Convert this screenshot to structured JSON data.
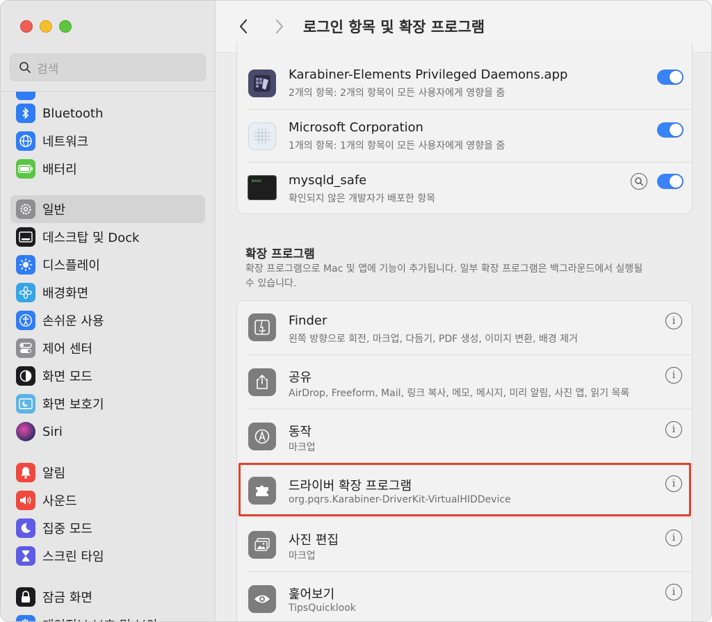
{
  "window": {
    "title": "로그인 항목 및 확장 프로그램"
  },
  "search": {
    "placeholder": "검색"
  },
  "sidebar": {
    "items": [
      {
        "label": "Bluetooth",
        "icon": "bluetooth-icon",
        "color": "#2f7cf6"
      },
      {
        "label": "네트워크",
        "icon": "globe-icon",
        "color": "#2f7cf6"
      },
      {
        "label": "배터리",
        "icon": "battery-icon",
        "color": "#5ac744"
      },
      {
        "label": "일반",
        "icon": "gear-icon",
        "color": "#8e8e93",
        "active": true
      },
      {
        "label": "데스크탑 및 Dock",
        "icon": "dock-icon",
        "color": "#1c1c1e"
      },
      {
        "label": "디스플레이",
        "icon": "sun-icon",
        "color": "#2f7cf6"
      },
      {
        "label": "배경화면",
        "icon": "flower-icon",
        "color": "#36a5e8"
      },
      {
        "label": "손쉬운 사용",
        "icon": "accessibility-icon",
        "color": "#2f7cf6"
      },
      {
        "label": "제어 센터",
        "icon": "toggles-icon",
        "color": "#8e8e93"
      },
      {
        "label": "화면 모드",
        "icon": "appearance-icon",
        "color": "#1c1c1e"
      },
      {
        "label": "화면 보호기",
        "icon": "screensaver-icon",
        "color": "#5ab4e8"
      },
      {
        "label": "Siri",
        "icon": "siri-icon",
        "color": "#3a2d6b"
      },
      {
        "label": "알림",
        "icon": "bell-icon",
        "color": "#f0483e"
      },
      {
        "label": "사운드",
        "icon": "speaker-icon",
        "color": "#f0483e"
      },
      {
        "label": "집중 모드",
        "icon": "moon-icon",
        "color": "#5e5ce6"
      },
      {
        "label": "스크린 타임",
        "icon": "hourglass-icon",
        "color": "#5e5ce6"
      },
      {
        "label": "잠금 화면",
        "icon": "lock-icon",
        "color": "#1c1c1e"
      },
      {
        "label": "개인정보 보호 및 보안",
        "icon": "hand-icon",
        "color": "#2f7cf6"
      }
    ]
  },
  "login_items": [
    {
      "title": "Karabiner-Elements Privileged Daemons.app",
      "subtitle": "2개의 항목: 2개의 항목이 모든 사용자에게 영향을 줌",
      "icon": "karabiner-icon",
      "enabled": true
    },
    {
      "title": "Microsoft Corporation",
      "subtitle": "1개의 항목: 1개의 항목이 모든 사용자에게 영향을 줌",
      "icon": "microsoft-icon",
      "enabled": true
    },
    {
      "title": "mysqld_safe",
      "subtitle": "확인되지 않은 개발자가 배포한 항목",
      "icon": "terminal-icon",
      "enabled": true
    }
  ],
  "extensions": {
    "title": "확장 프로그램",
    "description": "확장 프로그램으로 Mac 및 앱에 기능이 추가됩니다. 일부 확장 프로그램은 백그라운드에서 실행될 수 있습니다.",
    "items": [
      {
        "title": "Finder",
        "subtitle": "왼쪽 방향으로 회전, 마크업, 다듬기, PDF 생성, 이미지 변환, 배경 제거",
        "icon": "finder-icon"
      },
      {
        "title": "공유",
        "subtitle": "AirDrop, Freeform, Mail, 링크 복사, 메모, 메시지, 미리 알림, 사진 앱, 읽기 목록",
        "icon": "share-icon"
      },
      {
        "title": "동작",
        "subtitle": "마크업",
        "icon": "actions-icon"
      },
      {
        "title": "드라이버 확장 프로그램",
        "subtitle": "org.pqrs.Karabiner-DriverKit-VirtualHIDDevice",
        "icon": "puzzle-icon",
        "highlighted": true
      },
      {
        "title": "사진 편집",
        "subtitle": "마크업",
        "icon": "photos-icon"
      },
      {
        "title": "훑어보기",
        "subtitle": "TipsQuicklook",
        "icon": "eye-icon"
      }
    ]
  },
  "info_glyph": "i",
  "colors": {
    "accent": "#3a82f7",
    "highlight": "#e0412c"
  }
}
